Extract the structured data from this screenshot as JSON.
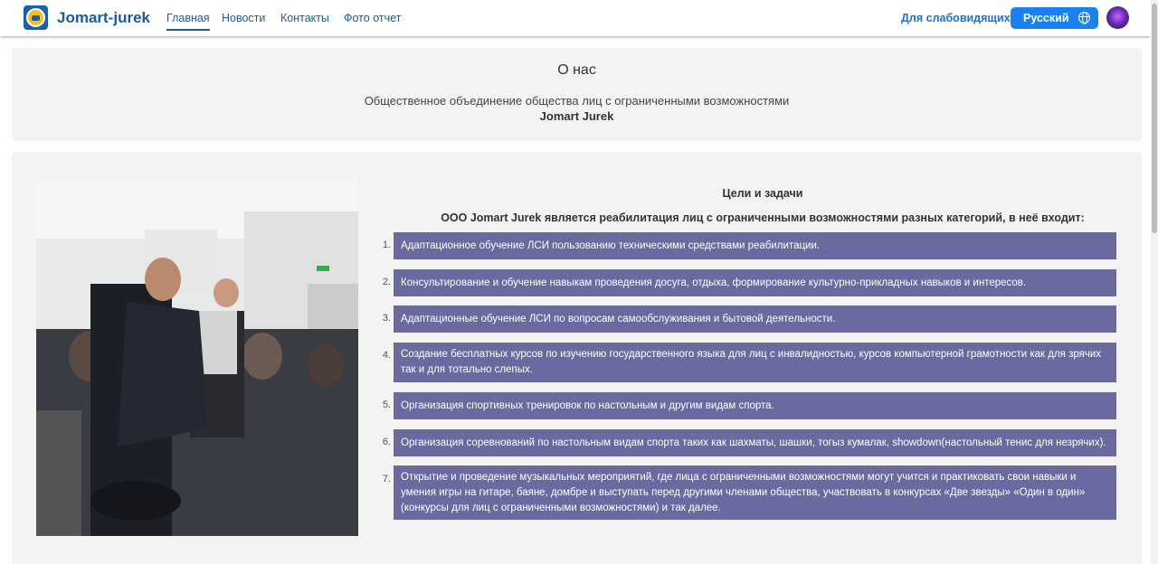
{
  "nav": {
    "brand": "Jomart-jurek",
    "links": [
      "Главная",
      "Новости",
      "Контакты",
      "Фото отчет"
    ],
    "low_vision": "Для слабовидящих",
    "language": "Русский"
  },
  "about": {
    "title": "О нас",
    "subtitle": "Общественное объединение общества лиц с ограниченными возможностями",
    "name": "Jomart Jurek"
  },
  "goals": {
    "title": "Цели и задачи",
    "lead": "ООО Jomart Jurek является реабилитация лиц с ограниченными возможностями разных категорий, в неё входит:",
    "items": [
      {
        "num": "1.",
        "text": "Адаптационное обучение ЛСИ пользованию техническими средствами реабилитации."
      },
      {
        "num": "2.",
        "text": "Консультирование и обучение навыкам проведения досуга, отдыха, формирование культурно-прикладных навыков и интересов."
      },
      {
        "num": "3.",
        "text": "Адаптационные обучение ЛСИ по вопросам самообслуживания и бытовой деятельности."
      },
      {
        "num": "4.",
        "text": "Создание бесплатных курсов по изучению государственного языка для лиц с инвалидностью, курсов компьютерной грамотности как для зрячих так и для тотально слепых."
      },
      {
        "num": "5.",
        "text": "Организация спортивных тренировок по настольным и другим видам спорта."
      },
      {
        "num": "6.",
        "text": "Организация соревнований по настольным видам спорта таких как шахматы, шашки, тогыз кумалак, showdown(настольный тенис для незрячих)."
      },
      {
        "num": "7.",
        "text": "Открытие и проведение музыкальных мероприятий, где лица с ограниченными возможностями могут учится и практиковать свои навыки и умения игры на гитаре, баяне, домбре и выступать перед другими членами общества, участвовать в конкурсах «Две звезды» «Один в один» (конкурсы для лиц с ограниченными возможностями) и так далее."
      }
    ]
  },
  "colors": {
    "brand": "#1d5c96",
    "language_button": "#1a82f0",
    "goal_background": "#6a6aa0",
    "card_background": "#f3f3f3"
  }
}
